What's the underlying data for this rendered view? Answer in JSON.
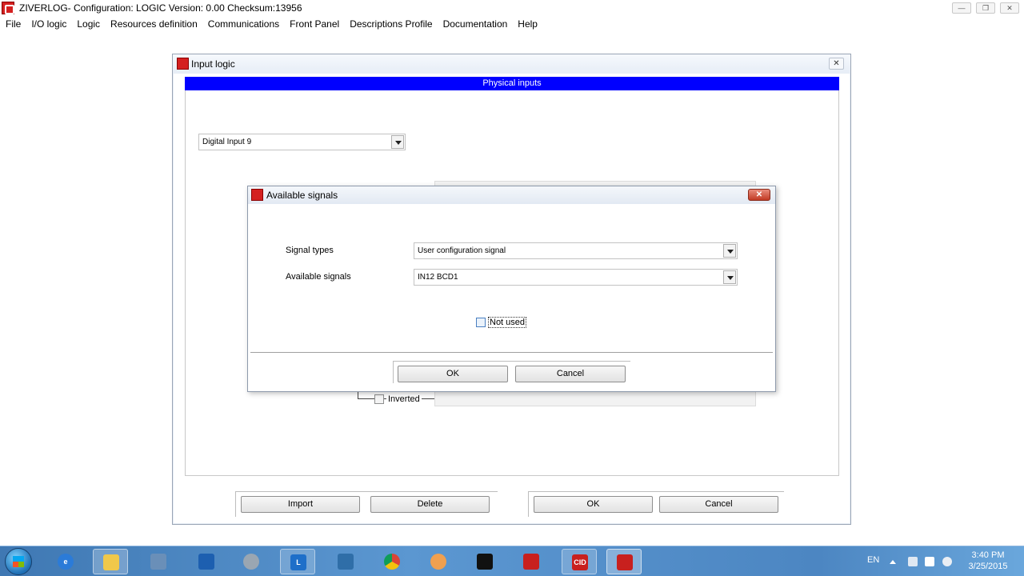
{
  "window": {
    "title": "ZIVERLOG- Configuration: LOGIC Version: 0.00 Checksum:13956",
    "controls": [
      "—",
      "❐",
      "✕"
    ]
  },
  "menu": [
    "File",
    "I/O logic",
    "Logic",
    "Resources definition",
    "Communications",
    "Front Panel",
    "Descriptions Profile",
    "Documentation",
    "Help"
  ],
  "input_logic": {
    "title": "Input logic",
    "header": "Physical inputs",
    "input_select": "Digital Input 9",
    "inverted_label": "Inverted",
    "buttons": {
      "import": "Import",
      "delete": "Delete",
      "ok": "OK",
      "cancel": "Cancel"
    }
  },
  "available_signals": {
    "title": "Available signals",
    "signal_types_label": "Signal types",
    "signal_types_value": "User configuration signal",
    "available_signals_label": "Available signals",
    "available_signals_value": "IN12 BCD1",
    "not_used_label": "Not used",
    "not_used_checked": false,
    "buttons": {
      "ok": "OK",
      "cancel": "Cancel"
    }
  },
  "taskbar": {
    "apps": [
      "explorer",
      "internet-explorer",
      "file-manager",
      "calculator",
      "outlook",
      "tools",
      "lync",
      "network",
      "chrome",
      "media",
      "cmd",
      "acrobat",
      "cid",
      "ziverlog"
    ],
    "cid_label": "CID",
    "language": "EN",
    "time": "3:40 PM",
    "date": "3/25/2015"
  },
  "colors": {
    "header_blue": "#0000ff",
    "logo_red": "#d42020"
  }
}
